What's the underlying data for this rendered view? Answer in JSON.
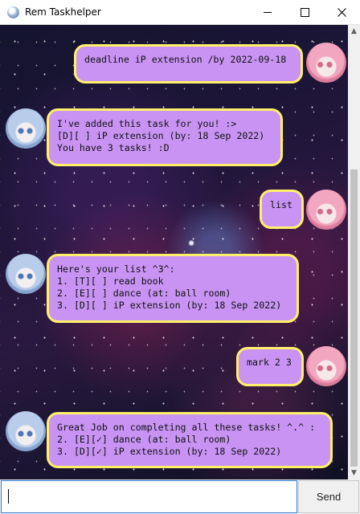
{
  "window": {
    "title": "Rem Taskhelper"
  },
  "messages": [
    {
      "sender": "user",
      "text": "deadline iP extension /by 2022-09-18"
    },
    {
      "sender": "bot",
      "text": "I've added this task for you! :>\n[D][ ] iP extension (by: 18 Sep 2022)\nYou have 3 tasks! :D"
    },
    {
      "sender": "user",
      "text": "list"
    },
    {
      "sender": "bot",
      "text": "Here's your list ^3^:\n1. [T][ ] read book\n2. [E][ ] dance (at: ball room)\n3. [D][ ] iP extension (by: 18 Sep 2022)"
    },
    {
      "sender": "user",
      "text": "mark 2 3"
    },
    {
      "sender": "bot",
      "text": "Great Job on completing all these tasks! ^.^ :\n2. [E][✓] dance (at: ball room)\n3. [D][✓] iP extension (by: 18 Sep 2022)"
    }
  ],
  "input": {
    "value": "",
    "placeholder": ""
  },
  "send_label": "Send",
  "colors": {
    "bubble": "#c993f4",
    "bubble_border": "#fff06a",
    "input_focus": "#2f7bd4"
  },
  "icons": {
    "app": "rem-avatar-icon",
    "user_avatar": "pink-hair-avatar",
    "bot_avatar": "blue-hair-avatar"
  }
}
